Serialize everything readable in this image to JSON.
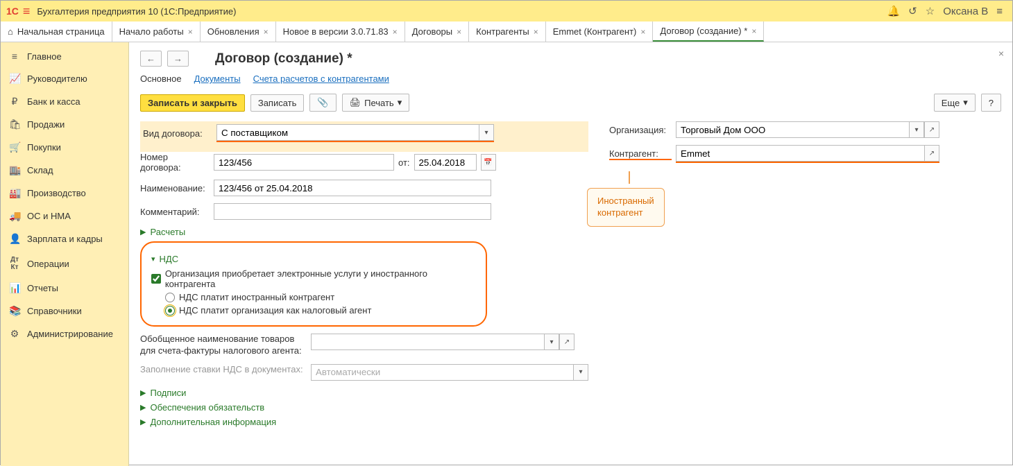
{
  "header": {
    "app_title": "Бухгалтерия предприятия 10  (1С:Предприятие)",
    "username": "Оксана В"
  },
  "tabs": {
    "home": "Начальная страница",
    "items": [
      "Начало работы",
      "Обновления",
      "Новое в версии 3.0.71.83",
      "Договоры",
      "Контрагенты",
      "Emmet (Контрагент)",
      "Договор (создание) *"
    ],
    "active_index": 6
  },
  "sidebar": {
    "items": [
      "Главное",
      "Руководителю",
      "Банк и касса",
      "Продажи",
      "Покупки",
      "Склад",
      "Производство",
      "ОС и НМА",
      "Зарплата и кадры",
      "Операции",
      "Отчеты",
      "Справочники",
      "Администрирование"
    ]
  },
  "page": {
    "title": "Договор (создание) *",
    "subtabs": {
      "main": "Основное",
      "docs": "Документы",
      "accounts": "Счета расчетов с контрагентами"
    },
    "toolbar": {
      "write_close": "Записать и закрыть",
      "write": "Записать",
      "print": "Печать",
      "more": "Еще",
      "help": "?"
    },
    "fields": {
      "contract_type_lbl": "Вид договора:",
      "contract_type_val": "С поставщиком",
      "org_lbl": "Организация:",
      "org_val": "Торговый Дом ООО",
      "number_lbl": "Номер договора:",
      "number_val": "123/456",
      "date_lbl": "от:",
      "date_val": "25.04.2018",
      "counterparty_lbl": "Контрагент:",
      "counterparty_val": "Emmet",
      "name_lbl": "Наименование:",
      "name_val": "123/456 от 25.04.2018",
      "comment_lbl": "Комментарий:",
      "comment_val": ""
    },
    "sections": {
      "calc": "Расчеты",
      "nds": "НДС",
      "sign": "Подписи",
      "guarantee": "Обеспечения обязательств",
      "extra": "Дополнительная информация"
    },
    "nds": {
      "checkbox": "Организация приобретает электронные услуги у иностранного контрагента",
      "radio1": "НДС платит иностранный контрагент",
      "radio2": "НДС платит организация как налоговый агент"
    },
    "aux": {
      "general_name_lbl": "Обобщенное наименование товаров для счета-фактуры налогового агента:",
      "vat_rate_lbl": "Заполнение ставки НДС в документах:",
      "vat_rate_val": "Автоматически"
    },
    "callout": "Иностранный\nконтрагент"
  }
}
